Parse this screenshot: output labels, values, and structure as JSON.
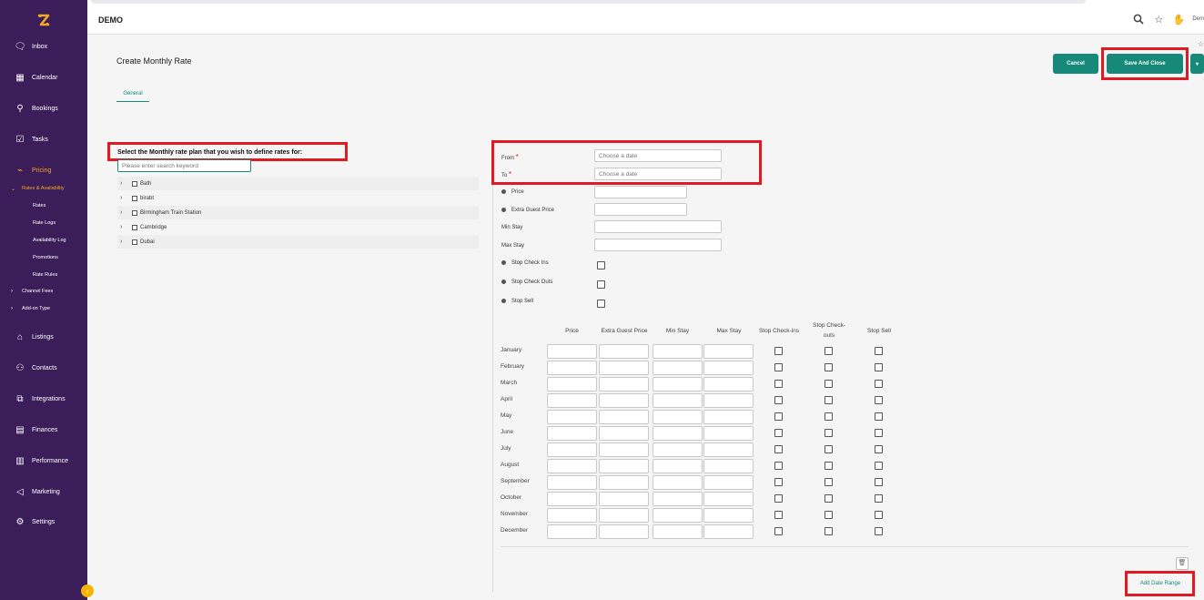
{
  "header": {
    "title": "DEMO",
    "user": "Dem"
  },
  "sidebar": {
    "items": [
      {
        "label": "Inbox",
        "icon": "inbox-icon"
      },
      {
        "label": "Calendar",
        "icon": "calendar-icon"
      },
      {
        "label": "Bookings",
        "icon": "bookings-icon"
      },
      {
        "label": "Tasks",
        "icon": "tasks-icon"
      },
      {
        "label": "Pricing",
        "icon": "tag-icon"
      },
      {
        "label": "Listings",
        "icon": "home-icon"
      },
      {
        "label": "Contacts",
        "icon": "contacts-icon"
      },
      {
        "label": "Integrations",
        "icon": "integrations-icon"
      },
      {
        "label": "Finances",
        "icon": "finances-icon"
      },
      {
        "label": "Performance",
        "icon": "performance-icon"
      },
      {
        "label": "Marketing",
        "icon": "megaphone-icon"
      },
      {
        "label": "Settings",
        "icon": "gear-icon"
      }
    ],
    "pricing_group": "Rates & Availability",
    "pricing_subitems": [
      "Rates",
      "Rate Logs",
      "Availability Log",
      "Promotions",
      "Rate Rules"
    ],
    "collapsed_groups": [
      "Channel Fees",
      "Add-on Type"
    ]
  },
  "page": {
    "title": "Create Monthly Rate",
    "cancel_label": "Cancel",
    "save_label": "Save And Close",
    "tab_general": "General"
  },
  "left_panel": {
    "prompt": "Select the Monthly rate plan that you wish to define rates for:",
    "search_placeholder": "Please enter search keyword",
    "tree": [
      "Bath",
      "birabt",
      "Birmingham Train Station",
      "Cambridge",
      "Dubai"
    ]
  },
  "form": {
    "from_label": "From",
    "to_label": "To",
    "date_placeholder": "Choose a date",
    "price_label": "Price",
    "extra_guest_label": "Extra Guest Price",
    "min_stay_label": "Min Stay",
    "max_stay_label": "Max Stay",
    "stop_checkins_label": "Stop Check Ins",
    "stop_checkouts_label": "Stop Check Outs",
    "stop_sell_label": "Stop Sell"
  },
  "grid": {
    "columns": [
      "Price",
      "Extra Guest Price",
      "Min Stay",
      "Max Stay",
      "Stop Check-ins",
      "Stop Check-outs",
      "Stop Sell"
    ],
    "months": [
      "January",
      "February",
      "March",
      "April",
      "May",
      "June",
      "July",
      "August",
      "September",
      "October",
      "November",
      "December"
    ]
  },
  "footer": {
    "add_date_range": "Add Date Range"
  },
  "colors": {
    "sidebar": "#3b1d5a",
    "accent": "#16897a",
    "active": "#f5a623",
    "highlight": "#e01a22"
  }
}
